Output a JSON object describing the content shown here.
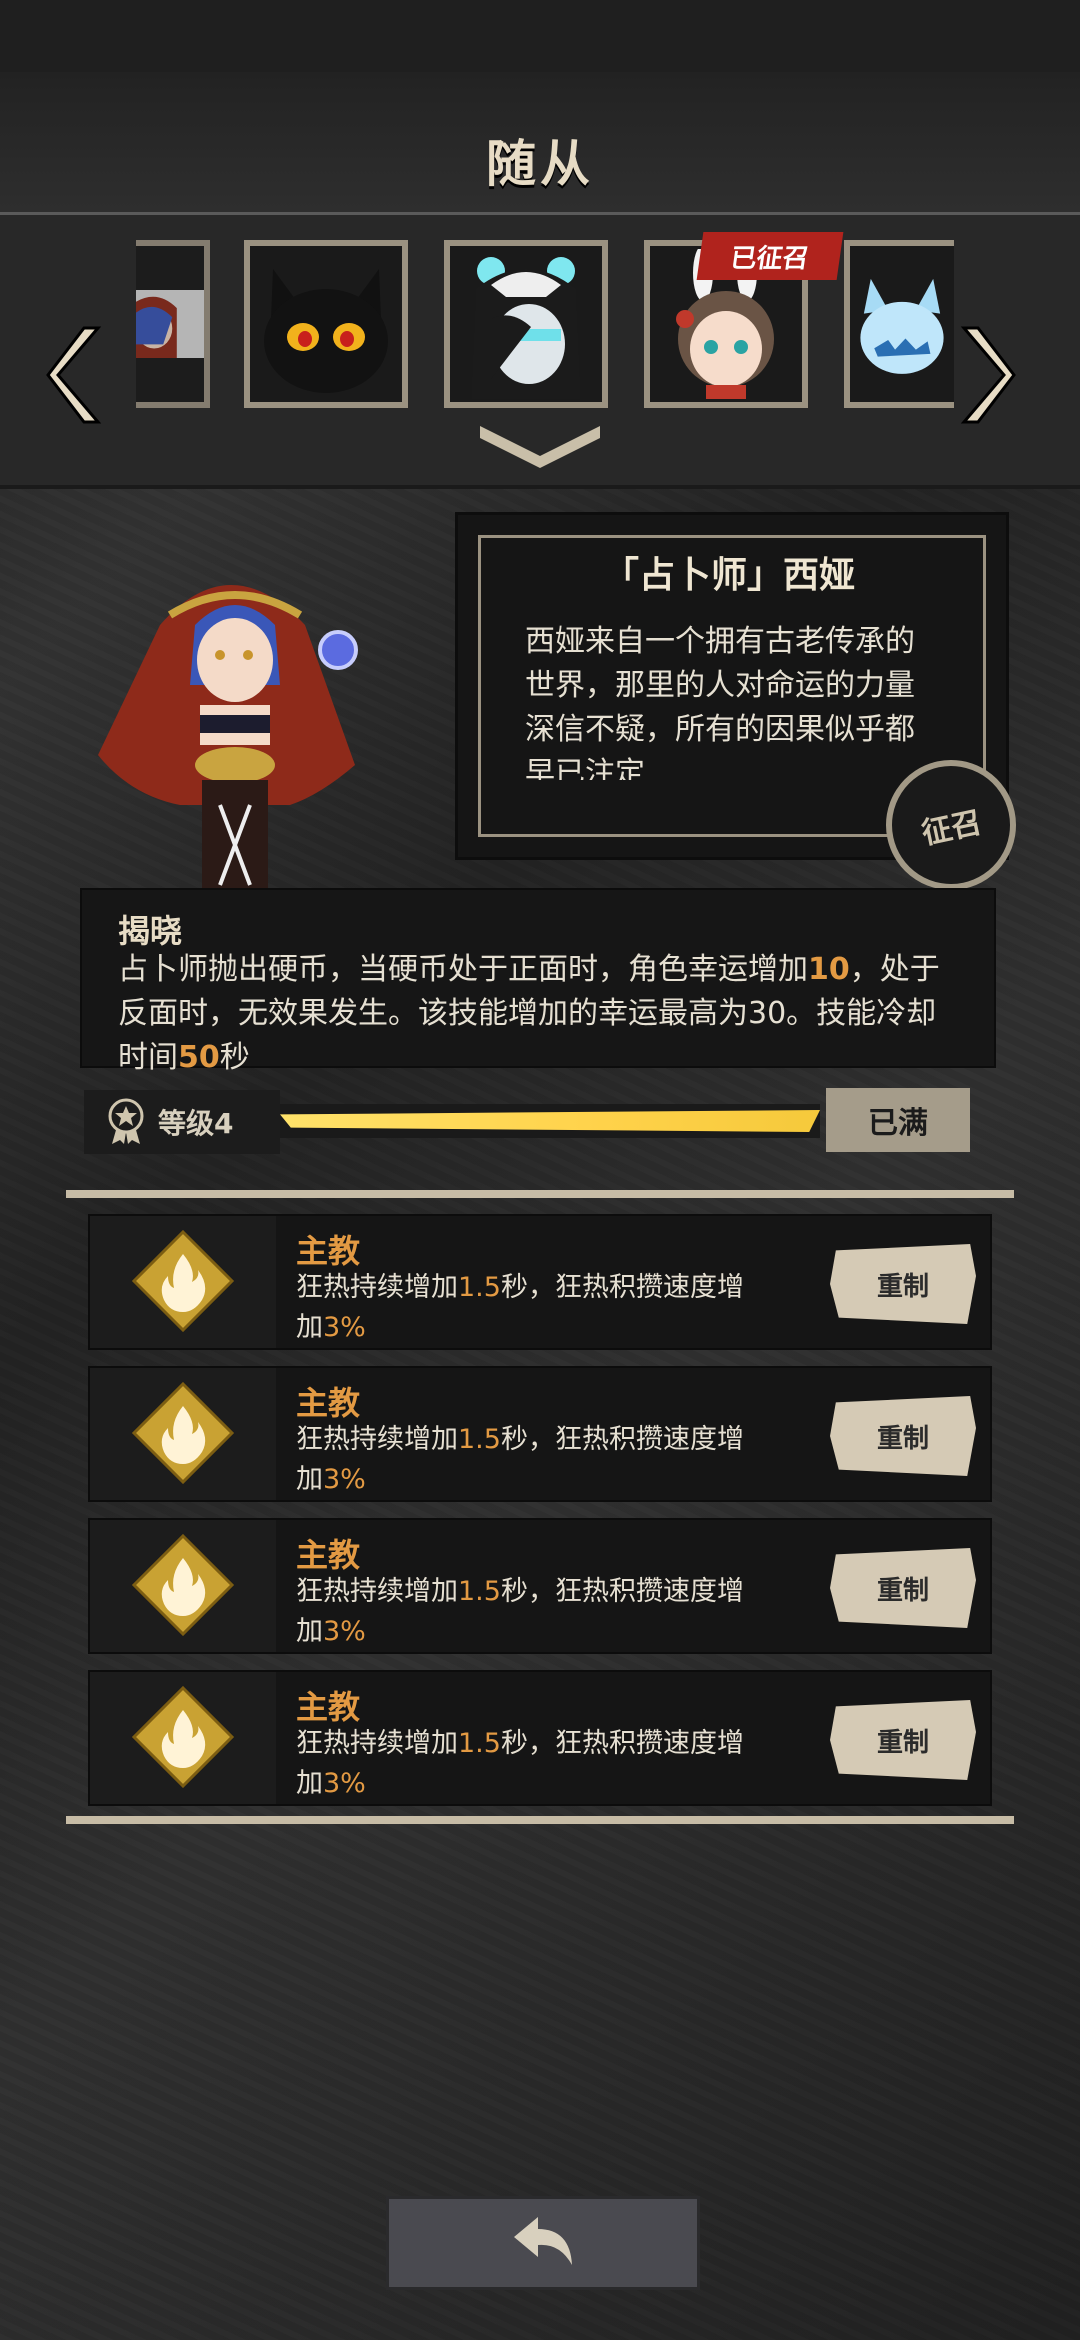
{
  "header": {
    "title": "随从"
  },
  "carousel": {
    "portraits": [
      {
        "name": "seer-portrait",
        "selected": true
      },
      {
        "name": "black-cat-portrait"
      },
      {
        "name": "maid-ghost-portrait"
      },
      {
        "name": "bunny-girl-portrait",
        "badge": "已征召"
      },
      {
        "name": "ice-fox-portrait"
      }
    ],
    "recruited_badge": "已征召"
  },
  "character": {
    "name": "「占卜师」西娅",
    "description": "西娅来自一个拥有古老传承的世界，那里的人对命运的力量深信不疑，所有的因果似乎都早已注定",
    "recruit_stamp": "征召"
  },
  "skill": {
    "title": "揭晓",
    "desc_part1": "占卜师抛出硬币，当硬币处于正面时，角色幸运增加",
    "desc_hl1": "10",
    "desc_part2": "，处于反面时，无效果发生。该技能增加的幸运最高为30。技能冷却时间",
    "desc_hl2": "50",
    "desc_part3": "秒"
  },
  "level": {
    "label": "等级4",
    "progress": 1.0,
    "max_label": "已满"
  },
  "traits": [
    {
      "name": "主教",
      "desc_a": "狂热持续增加",
      "num_a": "1.5",
      "desc_b": "秒，狂热积攒速度增加",
      "num_b": "3%",
      "button": "重制"
    },
    {
      "name": "主教",
      "desc_a": "狂热持续增加",
      "num_a": "1.5",
      "desc_b": "秒，狂热积攒速度增加",
      "num_b": "3%",
      "button": "重制"
    },
    {
      "name": "主教",
      "desc_a": "狂热持续增加",
      "num_a": "1.5",
      "desc_b": "秒，狂热积攒速度增加",
      "num_b": "3%",
      "button": "重制"
    },
    {
      "name": "主教",
      "desc_a": "狂热持续增加",
      "num_a": "1.5",
      "desc_b": "秒，狂热积攒速度增加",
      "num_b": "3%",
      "button": "重制"
    }
  ],
  "colors": {
    "accent": "#e39a43",
    "bar_fill": "#ffd24a",
    "badge_red": "#b0231d",
    "frame": "#9b9281"
  },
  "icons": [
    "chevron-left-icon",
    "chevron-right-icon",
    "chevron-down-icon",
    "flame-icon",
    "star-medal-icon",
    "back-arrow-icon"
  ]
}
